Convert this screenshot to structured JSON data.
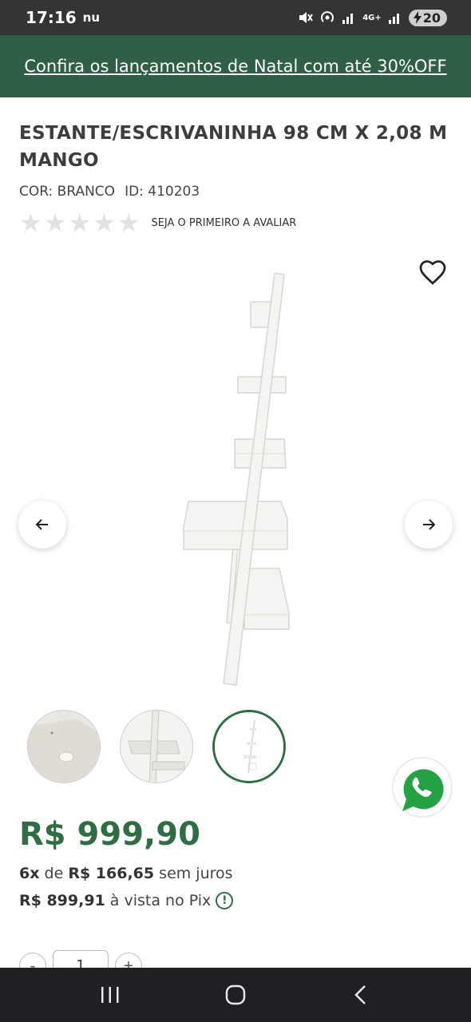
{
  "status_bar": {
    "time": "17:16",
    "carrier_icon_text": "nu",
    "network": "4G+",
    "battery": "20",
    "icons": [
      "mute-icon",
      "hotspot-icon",
      "signal-icon",
      "signal-icon",
      "battery-charging-icon"
    ]
  },
  "promo": {
    "text": "Confira os lançamentos de Natal com até 30%OFF"
  },
  "product": {
    "title": "ESTANTE/ESCRIVANINHA 98 CM X 2,08 M MANGO",
    "color": "COR: BRANCO",
    "id": "ID: 410203",
    "rating_text": "SEJA O PRIMEIRO A AVALIAR",
    "stars": [
      "★",
      "★",
      "★",
      "★",
      "★"
    ]
  },
  "gallery": {
    "favorite_icon": "heart-icon",
    "prev_icon": "arrow-left-icon",
    "next_icon": "arrow-right-icon",
    "thumbnails": 3,
    "active_thumbnail": 3
  },
  "pricing": {
    "price": "R$ 999,90",
    "installments_count": "6x",
    "installments_de": "de",
    "installments_value": "R$ 166,65",
    "installments_suffix": "sem juros",
    "pix_value": "R$ 899,91",
    "pix_suffix": "à vista no Pix",
    "info_icon_glyph": "!"
  },
  "quantity": {
    "minus": "-",
    "value": "1",
    "plus": "+"
  },
  "colors": {
    "brand_green": "#2f6e45",
    "banner_green": "#2f5f45",
    "whatsapp_green": "#25a244"
  }
}
